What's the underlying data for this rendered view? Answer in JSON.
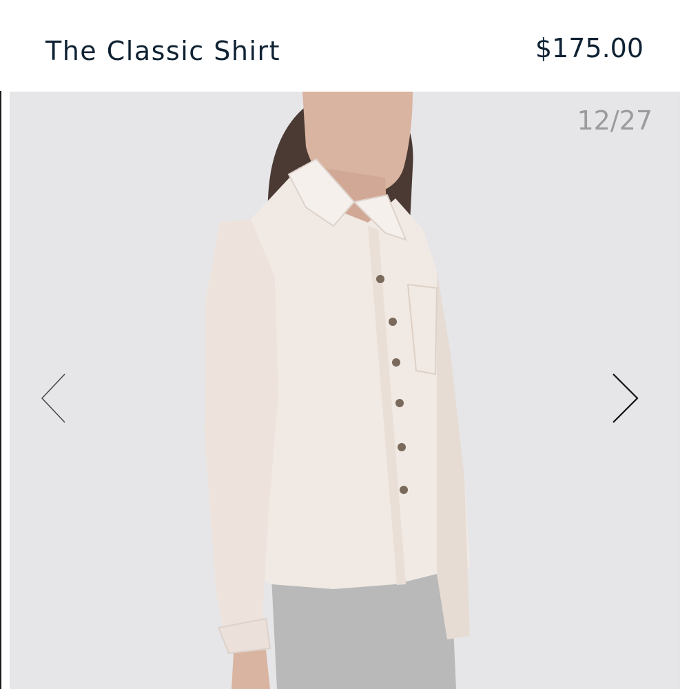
{
  "product": {
    "title": "The Classic Shirt",
    "price": "$175.00"
  },
  "gallery": {
    "counter": "12/27",
    "prev_icon": "chevron-left-icon",
    "next_icon": "chevron-right-icon",
    "background_color": "#e6e6e8"
  },
  "colors": {
    "text": "#0f2233",
    "counter": "#9b9b9b",
    "shirt": "#f1e9e3",
    "pants": "#b9b9b9",
    "hair": "#4a3a33",
    "skin": "#d9b4a0"
  }
}
